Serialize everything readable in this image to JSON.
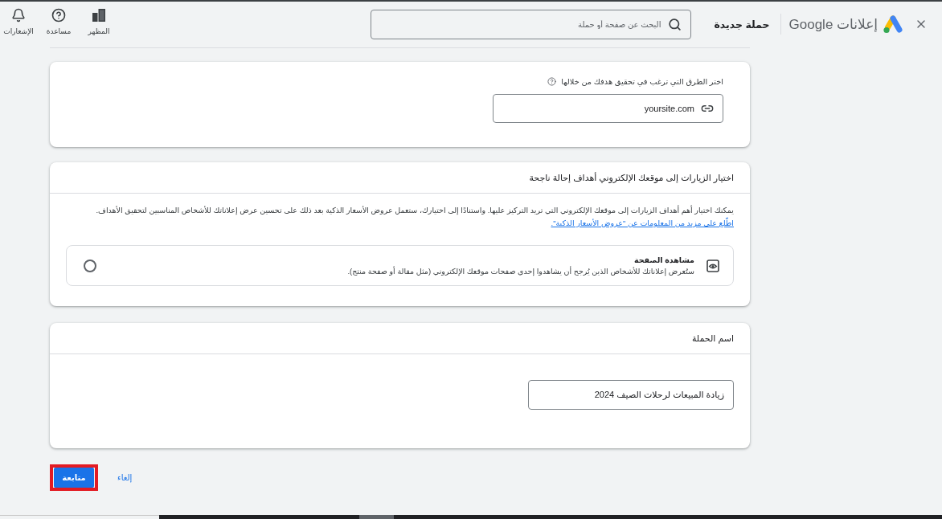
{
  "header": {
    "product_name": "إعلانات Google",
    "page_title": "حملة جديدة",
    "search": {
      "placeholder": "البحث عن صفحة أو حملة"
    },
    "actions": [
      {
        "label": "المظهر"
      },
      {
        "label": "مساعدة"
      },
      {
        "label": "الإشعارات"
      }
    ]
  },
  "website_card": {
    "label": "اختر الطرق التي ترغب في تحقيق هدفك من خلالها",
    "url_field": {
      "value": "yoursite.com"
    }
  },
  "goal_card": {
    "title": "اختيار الزيارات إلى موقعك الإلكتروني أهداف إحالة ناجحة",
    "description": "يمكنك اختيار أهم أهداف الزيارات إلى موقعك الإلكتروني التي تريد التركيز عليها. واستنادًا إلى اختيارك، ستعمل عروض الأسعار الذكية بعد ذلك على تحسين عرض إعلاناتك للأشخاص المناسبين لتحقيق الأهداف.",
    "link": "اطّلع على مزيد من المعلومات عن \"عروض الأسعار الذكية\".",
    "options": [
      {
        "title": "مشاهدة الصفحة",
        "description": "ستُعرض إعلاناتك للأشخاص الذين يُرجح أن يشاهدوا إحدى صفحات موقعك الإلكتروني (مثل مقالة أو صفحة منتج).",
        "selected": false
      }
    ]
  },
  "campaign_name_card": {
    "title": "اسم الحملة",
    "name_field": {
      "value": "زيادة المبيعات لرحلات الصيف 2024"
    }
  },
  "footer_buttons": [
    {
      "label": "إلغاء",
      "kind": "text",
      "highlighted": false
    },
    {
      "label": "متابعة",
      "kind": "primary",
      "highlighted": true
    }
  ]
}
